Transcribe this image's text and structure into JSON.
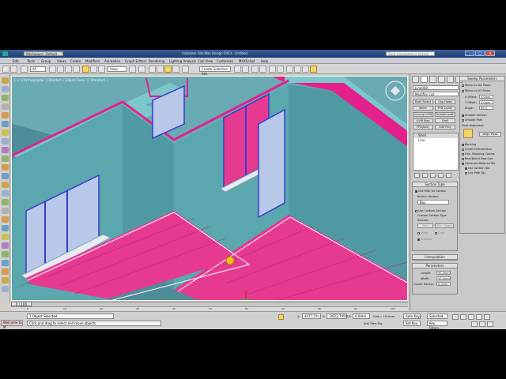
{
  "app": {
    "workspace_label": "Workspace: Default",
    "window_title": "Autodesk 3ds Max Design 2013 - Untitled",
    "search_placeholder": "Type a keyword or phrase",
    "min_label": "_",
    "max_label": "□",
    "close_label": "x"
  },
  "menu": [
    "Edit",
    "Tools",
    "Group",
    "Views",
    "Create",
    "Modifiers",
    "Animation",
    "Graph Editors",
    "Rendering",
    "Lighting Analysis",
    "Civil View",
    "Customize",
    "MAXScript",
    "Help"
  ],
  "toolbar": {
    "selection_filter": "All",
    "view_dropdown": "View",
    "named_selection": "Create Selection Set"
  },
  "viewport": {
    "label": "[ + ] [Orthographic ] [Shaded + Edged Faces ] [ Standard ]",
    "colors": {
      "wall": "#5aa7ad",
      "floor": "#e63a90",
      "trim": "#e4208c",
      "window": "#3a3acf"
    }
  },
  "timeline": {
    "frame_slider": "0 / 100",
    "ticks": [
      "0",
      "10",
      "20",
      "30",
      "40",
      "50",
      "60",
      "70",
      "80",
      "90",
      "100"
    ]
  },
  "status": {
    "welcome": "Welcome to M",
    "selected": "1 Object Selected",
    "prompt": "Click and drag to select and move objects",
    "x_label": "X:",
    "x_value": "4477,7m",
    "y_label": "Y:",
    "y_value": "-3622,795m",
    "z_label": "Z:",
    "z_value": "0,0mm",
    "grid": "Grid = 10,0mm",
    "autokey": "Auto Key",
    "setkey": "Set Key",
    "selected_dropdown": "Selected",
    "key_filters": "Key Filters...",
    "add_time_tag": "Add Time Tag"
  },
  "command_panel": {
    "object_name": "Line008",
    "modifier_list": "Modifier List",
    "mod_buttons": [
      "Shell Select",
      "Cap Holes",
      "Bend",
      "FFD 2x2x2",
      "Unwrap UVW",
      "TurboSmooth",
      "UVW Map",
      "Shell",
      "FFD(box)",
      "Edit Poly"
    ],
    "stack": [
      "Shell",
      "Line"
    ],
    "section_type": {
      "header": "Section Type",
      "use_path": "Use Path for Section",
      "built_in": "Built-In Section",
      "built_in_value": "Box",
      "use_custom": "Use Custom Section",
      "custom_section_type": "Custom Section Type",
      "section_label": "Section:",
      "pick_shape": "Pick Shape",
      "pick": "Pick",
      "move": "Move",
      "copy": "Copy",
      "instance": "Instance"
    },
    "interpolation": {
      "header": "Interpolation",
      "parameters": "Parameters",
      "length_label": "Length:",
      "length_value": "50,0mm",
      "width_label": "Width:",
      "width_value": "50,0mm",
      "corner_label": "Corner Radius:",
      "corner_value": "0,0mm"
    },
    "sweep_params": {
      "header": "Sweep Parameters",
      "mirror_xz": "Mirror on XZ Plane",
      "mirror_xy": "Mirror on XY Plane",
      "x_offset_label": "X Offset:",
      "x_offset_value": "0,0mm",
      "y_offset_label": "Y Offset:",
      "y_offset_value": "0,0mm",
      "angle_label": "Angle:",
      "angle_value": "90,0",
      "smooth_section": "Smooth Section",
      "smooth_path": "Smooth Path",
      "pivot_alignment": "Pivot Alignment",
      "align_pivot": "Align Pivot",
      "banking": "Banking",
      "union": "Union Intersections",
      "gen_mapping": "Gen. Mapping Coords",
      "real_world": "Real-World Map Size",
      "gen_mat": "Generate Material IDs",
      "use_section_ids": "Use Section IDs",
      "use_path_ids": "Use Path IDs"
    }
  }
}
